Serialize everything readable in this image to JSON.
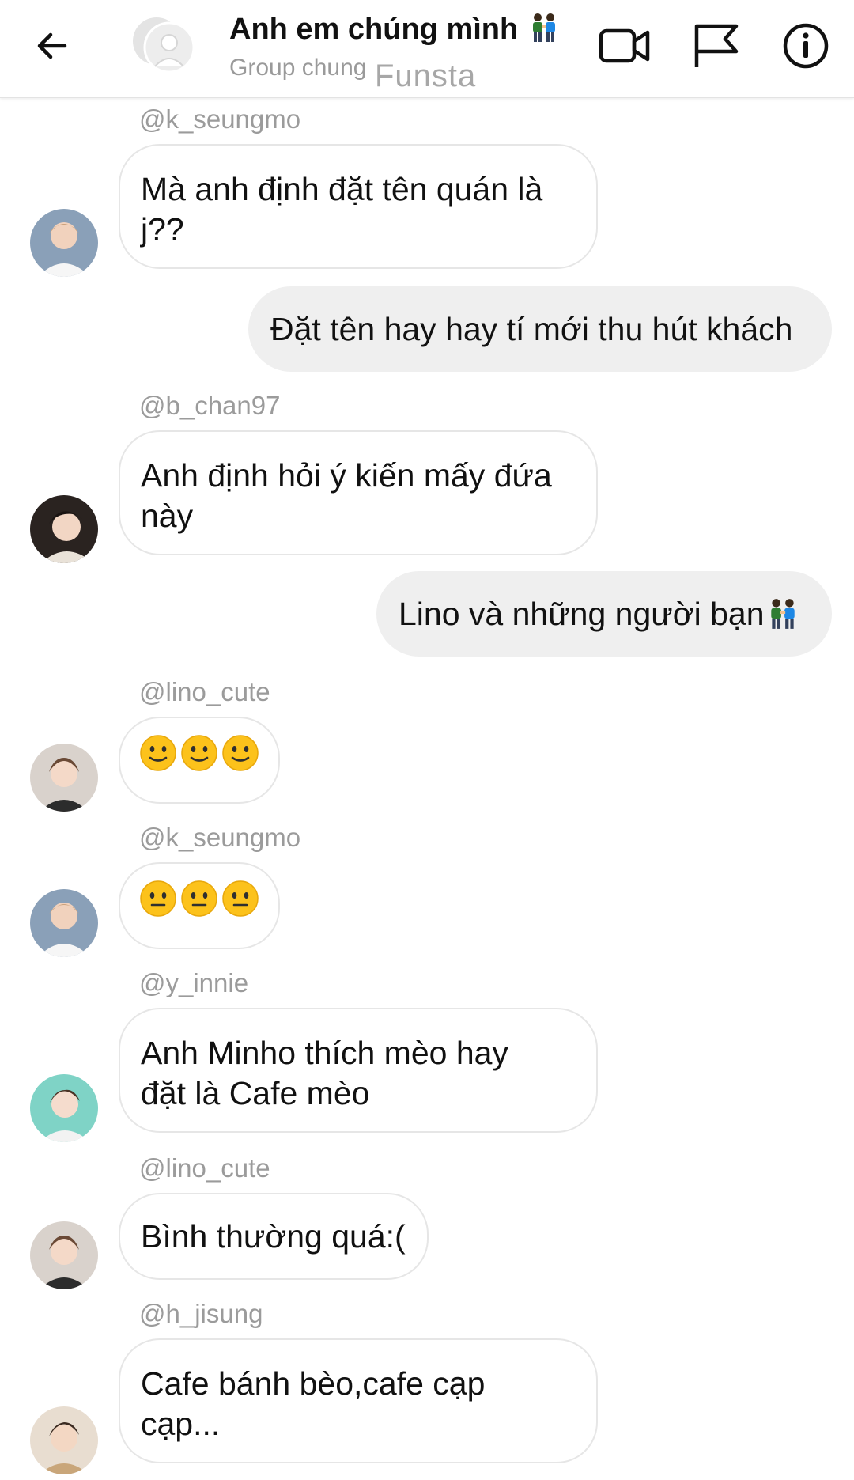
{
  "header": {
    "title": "Anh em chúng mình",
    "subtitle": "Group chung",
    "watermark": "Funsta",
    "icons": {
      "back": "arrow-left-icon",
      "video": "video-camera-icon",
      "flag": "flag-icon",
      "info": "info-icon",
      "title_emoji": "two-men-holding-hands-icon"
    }
  },
  "colors": {
    "incoming_bubble": "#ffffff",
    "incoming_border": "#e6e6e6",
    "outgoing_bubble": "#efefef",
    "username_text": "#9b9b9b",
    "text": "#111111"
  },
  "messages": [
    {
      "type": "incoming",
      "username": "@k_seungmo",
      "text_lines": [
        "Mà anh định đặt tên quán là",
        "j??"
      ]
    },
    {
      "type": "outgoing",
      "text": "Đặt tên hay hay tí mới thu hút khách"
    },
    {
      "type": "incoming",
      "username": "@b_chan97",
      "text_lines": [
        "Anh định hỏi ý kiến mấy đứa",
        "này"
      ]
    },
    {
      "type": "outgoing",
      "text": "Lino và những người bạn",
      "trailing_icon": "two-men-holding-hands-icon"
    },
    {
      "type": "incoming",
      "username": "@lino_cute",
      "emojis": [
        "slightly-smiling-face-icon",
        "slightly-smiling-face-icon",
        "slightly-smiling-face-icon"
      ]
    },
    {
      "type": "incoming",
      "username": "@k_seungmo",
      "emojis": [
        "neutral-face-icon",
        "neutral-face-icon",
        "neutral-face-icon"
      ]
    },
    {
      "type": "incoming",
      "username": "@y_innie",
      "text_lines": [
        "Anh Minho thích mèo hay",
        "đặt là Cafe mèo"
      ]
    },
    {
      "type": "incoming",
      "username": "@lino_cute",
      "text_lines": [
        "Bình thường quá:("
      ]
    },
    {
      "type": "incoming",
      "username": "@h_jisung",
      "text_lines": [
        "Cafe bánh bèo,cafe cạp",
        "cạp..."
      ]
    }
  ]
}
